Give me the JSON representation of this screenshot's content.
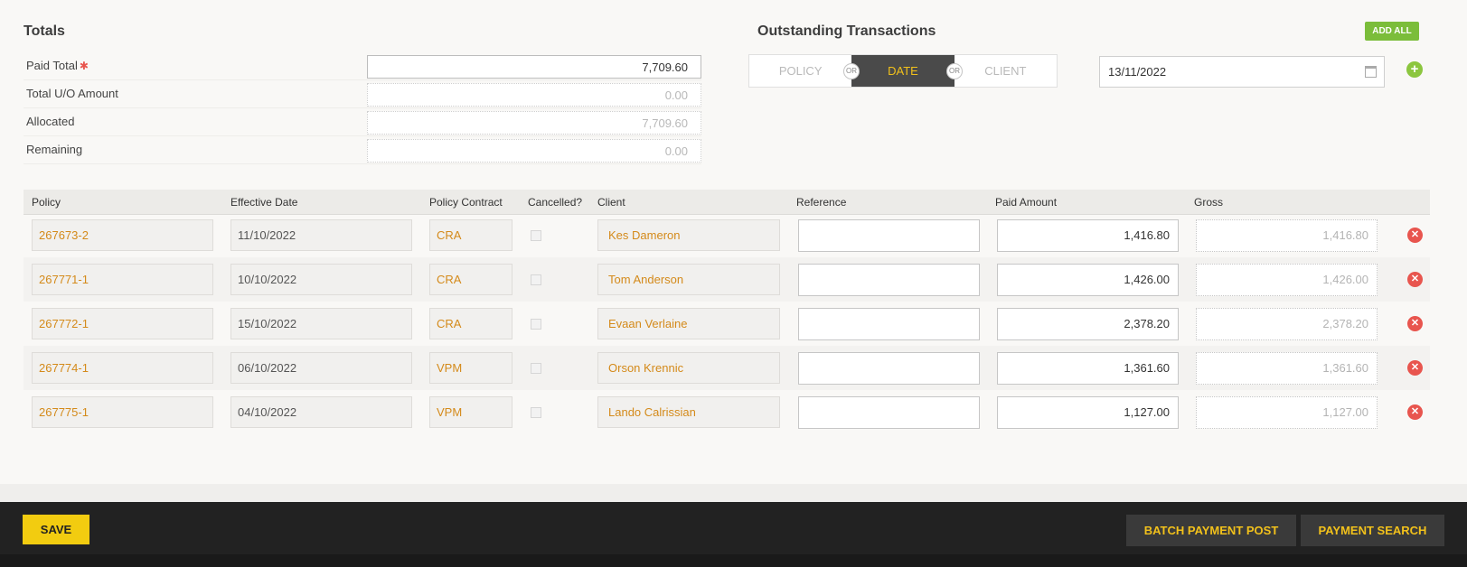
{
  "totals": {
    "title": "Totals",
    "paid_total_label": "Paid Total",
    "required_marker": "✱",
    "paid_total_value": "7,709.60",
    "uo_label": "Total U/O Amount",
    "uo_value": "0.00",
    "allocated_label": "Allocated",
    "allocated_value": "7,709.60",
    "remaining_label": "Remaining",
    "remaining_value": "0.00"
  },
  "outstanding": {
    "title": "Outstanding Transactions",
    "add_all_label": "ADD ALL",
    "options": [
      "POLICY",
      "DATE",
      "CLIENT"
    ],
    "selected": "DATE",
    "or_label": "OR",
    "date_value": "13/11/2022",
    "calendar_icon": "calendar-icon",
    "add_icon": "plus-circle-icon"
  },
  "table": {
    "headers": [
      "Policy",
      "Effective Date",
      "Policy Contract",
      "Cancelled?",
      "Client",
      "Reference",
      "Paid Amount",
      "Gross"
    ],
    "rows": [
      {
        "policy": "267673-2",
        "effective": "11/10/2022",
        "contract": "CRA",
        "cancelled": false,
        "client": "Kes Dameron",
        "reference": "",
        "paid": "1,416.80",
        "gross": "1,416.80"
      },
      {
        "policy": "267771-1",
        "effective": "10/10/2022",
        "contract": "CRA",
        "cancelled": false,
        "client": "Tom Anderson",
        "reference": "",
        "paid": "1,426.00",
        "gross": "1,426.00"
      },
      {
        "policy": "267772-1",
        "effective": "15/10/2022",
        "contract": "CRA",
        "cancelled": false,
        "client": "Evaan Verlaine",
        "reference": "",
        "paid": "2,378.20",
        "gross": "2,378.20"
      },
      {
        "policy": "267774-1",
        "effective": "06/10/2022",
        "contract": "VPM",
        "cancelled": false,
        "client": "Orson Krennic",
        "reference": "",
        "paid": "1,361.60",
        "gross": "1,361.60"
      },
      {
        "policy": "267775-1",
        "effective": "04/10/2022",
        "contract": "VPM",
        "cancelled": false,
        "client": "Lando Calrissian",
        "reference": "",
        "paid": "1,127.00",
        "gross": "1,127.00"
      }
    ],
    "delete_icon": "remove-circle-icon"
  },
  "footer": {
    "save_label": "SAVE",
    "batch_label": "BATCH PAYMENT POST",
    "search_label": "PAYMENT SEARCH"
  },
  "colors": {
    "accent_yellow": "#f2c11b",
    "link_orange": "#d48a1a",
    "add_green": "#7bbd3a",
    "delete_red": "#e8554e",
    "footer_bg": "#222222"
  }
}
